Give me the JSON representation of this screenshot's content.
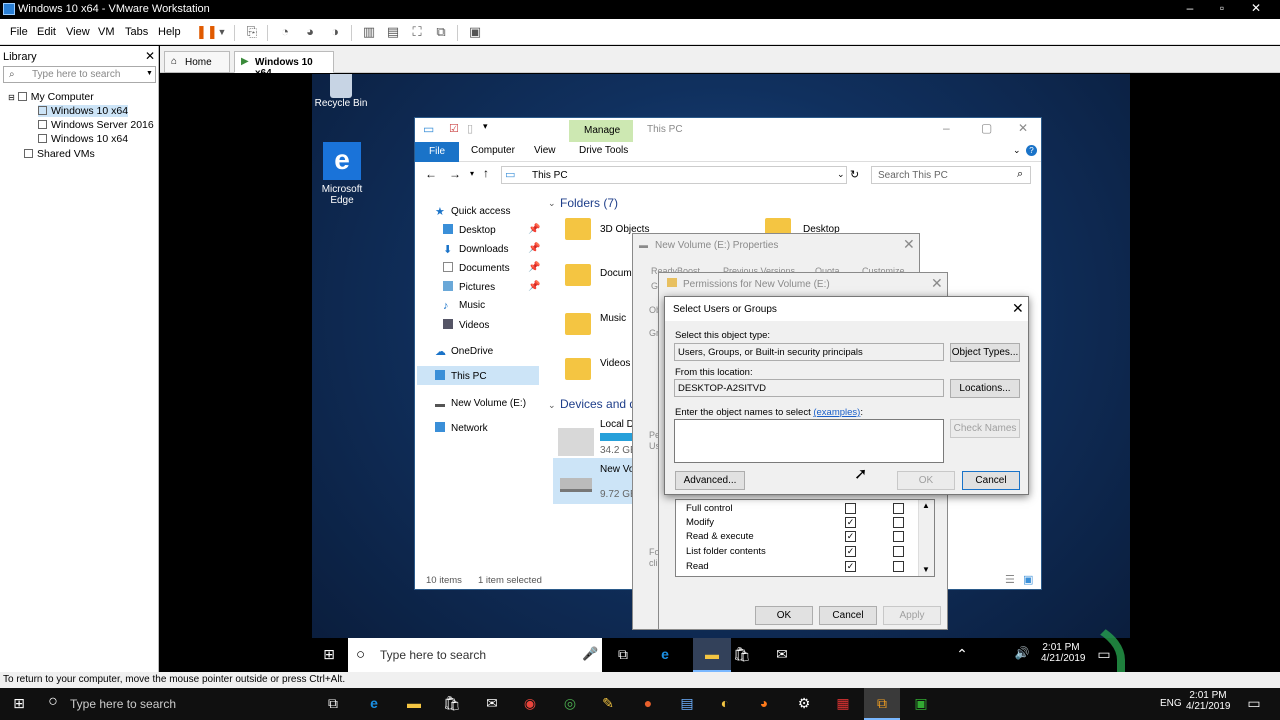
{
  "vm_window": {
    "title": "Windows 10 x64 - VMware Workstation",
    "minimize": "–",
    "maximize": "▫",
    "close": "✕"
  },
  "menu": [
    "File",
    "Edit",
    "View",
    "VM",
    "Tabs",
    "Help"
  ],
  "library": {
    "title": "Library",
    "close": "✕",
    "search_placeholder": "Type here to search",
    "items": [
      "My Computer",
      "Windows 10 x64",
      "Windows Server 2016",
      "Windows 10 x64",
      "Shared VMs"
    ]
  },
  "tabs": {
    "home": "Home",
    "active": "Windows 10 x64"
  },
  "desktop": {
    "recycle_bin": "Recycle Bin",
    "edge_line1": "Microsoft",
    "edge_line2": "Edge"
  },
  "explorer": {
    "title": "This PC",
    "manage": "Manage",
    "tabs": [
      "File",
      "Computer",
      "View",
      "Drive Tools"
    ],
    "address": "This PC",
    "search_placeholder": "Search This PC",
    "nav": [
      "Quick access",
      "Desktop",
      "Downloads",
      "Documents",
      "Pictures",
      "Music",
      "Videos",
      "OneDrive",
      "This PC",
      "New Volume (E:)",
      "Network"
    ],
    "folders_header": "Folders (7)",
    "folders": [
      "3D Objects",
      "Desktop",
      "Docum",
      "Music",
      "Videos"
    ],
    "devices_header": "Devices and d",
    "devices": [
      {
        "name": "Local Di",
        "size": "34.2 GB"
      },
      {
        "name": "New Vo",
        "size": "9.72 GB"
      }
    ],
    "status_items": "10 items",
    "status_selected": "1 item selected"
  },
  "properties_dialog": {
    "title": "New Volume (E:) Properties",
    "tabs": [
      "ReadyBoost",
      "Previous Versions",
      "Quota",
      "Customize"
    ],
    "g": "Ge",
    "ob": "Ob",
    "gr": "Gr",
    "pe": "Pe",
    "us": "Us",
    "fo": "Fo",
    "cli": "cli"
  },
  "permissions_dialog": {
    "title": "Permissions for New Volume (E:)",
    "rows": [
      {
        "label": "Full control",
        "allow": false,
        "deny": false
      },
      {
        "label": "Modify",
        "allow": true,
        "deny": false
      },
      {
        "label": "Read & execute",
        "allow": true,
        "deny": false
      },
      {
        "label": "List folder contents",
        "allow": true,
        "deny": false
      },
      {
        "label": "Read",
        "allow": true,
        "deny": false
      }
    ],
    "ok": "OK",
    "cancel": "Cancel",
    "apply": "Apply"
  },
  "select_dialog": {
    "title": "Select Users or Groups",
    "object_type_label": "Select this object type:",
    "object_type_value": "Users, Groups, or Built-in security principals",
    "object_types_btn": "Object Types...",
    "location_label": "From this location:",
    "location_value": "DESKTOP-A2SITVD",
    "locations_btn": "Locations...",
    "enter_label": "Enter the object names to select",
    "examples": "(examples)",
    "colon": ":",
    "check_names": "Check Names",
    "advanced": "Advanced...",
    "ok": "OK",
    "cancel": "Cancel"
  },
  "vm_taskbar": {
    "search": "Type here to search",
    "time": "2:01 PM",
    "date": "4/21/2019"
  },
  "status_bar": "To return to your computer, move the mouse pointer outside or press Ctrl+Alt.",
  "host_taskbar": {
    "search": "Type here to search",
    "lang": "ENG",
    "time": "2:01 PM",
    "date": "4/21/2019"
  }
}
